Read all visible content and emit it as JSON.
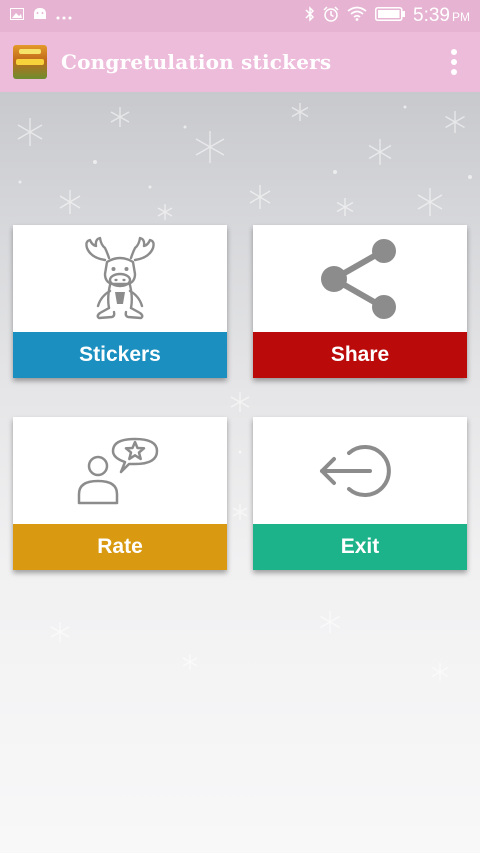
{
  "status_bar": {
    "time": "5:39",
    "ampm": "PM",
    "icons": [
      "image-icon",
      "android-icon",
      "more-dots-icon",
      "bluetooth-icon",
      "alarm-icon",
      "wifi-icon",
      "battery-icon"
    ]
  },
  "app_bar": {
    "title": "Congretulation stickers",
    "icon": "app-logo",
    "menu_icon": "overflow-menu-icon"
  },
  "tiles": {
    "stickers": {
      "label": "Stickers",
      "color": "#1a8fc0",
      "icon": "moose-icon"
    },
    "share": {
      "label": "Share",
      "color": "#bb0a0a",
      "icon": "share-icon"
    },
    "rate": {
      "label": "Rate",
      "color": "#d99a12",
      "icon": "rate-user-star-icon"
    },
    "exit": {
      "label": "Exit",
      "color": "#1db38a",
      "icon": "exit-icon"
    }
  },
  "colors": {
    "status_bar": "#e6b4d2",
    "app_bar": "#edbcdb",
    "icon_gray": "#8c8c8c"
  }
}
